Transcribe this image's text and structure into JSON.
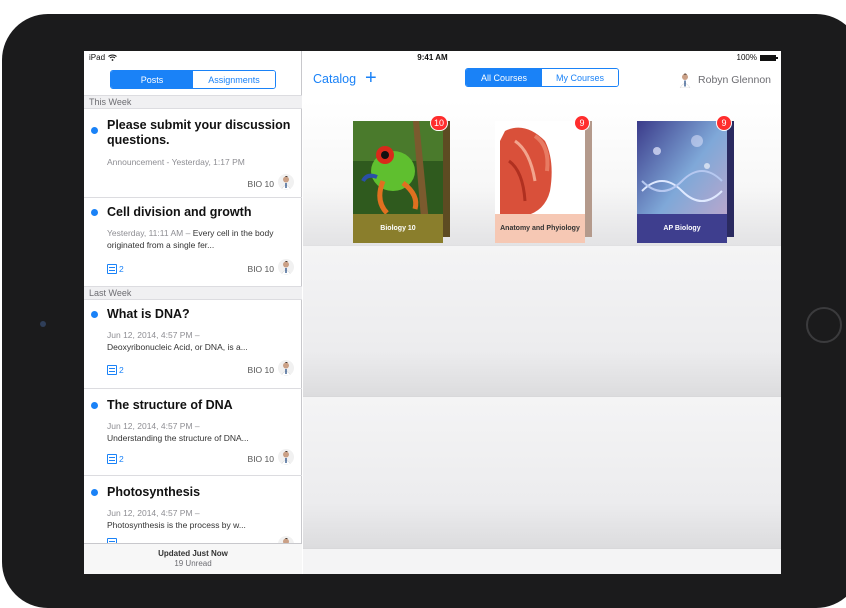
{
  "status_bar": {
    "device": "iPad",
    "time": "9:41 AM",
    "battery": "100%"
  },
  "left_panel": {
    "tabs": [
      {
        "label": "Posts",
        "active": true
      },
      {
        "label": "Assignments",
        "active": false
      }
    ],
    "sections": [
      {
        "label": "This Week"
      },
      {
        "label": "Last Week"
      }
    ],
    "posts": [
      {
        "title": "Please submit your discussion questions.",
        "meta": "Announcement - Yesterday, 1:17 PM",
        "course": "BIO 10"
      },
      {
        "title": "Cell division and growth",
        "meta": "Yesterday, 11:11 AM – ",
        "body": "Every cell in the body originated from a single fer...",
        "attachments": "2",
        "course": "BIO 10"
      },
      {
        "title": "What is DNA?",
        "meta": "Jun 12, 2014, 4:57 PM –",
        "body": "Deoxyribonucleic Acid, or DNA, is a...",
        "attachments": "2",
        "course": "BIO 10"
      },
      {
        "title": "The structure of DNA",
        "meta": "Jun 12, 2014, 4:57 PM –",
        "body": "Understanding the structure of DNA...",
        "attachments": "2",
        "course": "BIO 10"
      },
      {
        "title": "Photosynthesis",
        "meta": "Jun 12, 2014, 4:57 PM –",
        "body": "Photosynthesis is the process by w..."
      }
    ],
    "footer": {
      "updated": "Updated Just Now",
      "unread": "19 Unread"
    }
  },
  "right_panel": {
    "catalog_label": "Catalog",
    "course_tabs": [
      {
        "label": "All Courses",
        "active": true
      },
      {
        "label": "My Courses",
        "active": false
      }
    ],
    "user_name": "Robyn Glennon",
    "books": [
      {
        "title": "Biology 10",
        "badge": "10",
        "label_color": "#8a7e2c",
        "spine_color": "#5d4b22"
      },
      {
        "title": "Anatomy and Phyiology",
        "badge": "9",
        "label_color": "#f6c8b4",
        "spine_color": "#b49a8c"
      },
      {
        "title": "AP Biology",
        "badge": "9",
        "label_color": "#3e3e8e",
        "spine_color": "#2a2a60"
      }
    ]
  },
  "colors": {
    "accent": "#1a82f7",
    "badge": "#ff2d2d"
  }
}
